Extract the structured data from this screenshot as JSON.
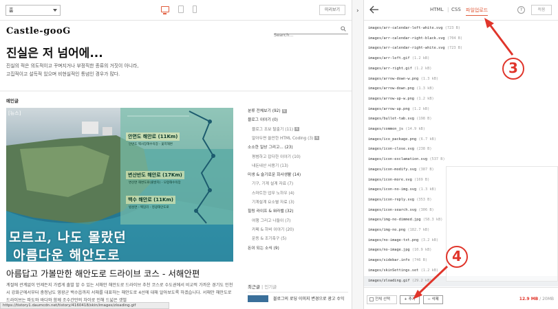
{
  "toolbar": {
    "skin_select_value": "홈",
    "preview_label": "미리보기"
  },
  "blog": {
    "logo": "Castle-gooG",
    "search_placeholder": "Search...",
    "hero_title": "진실은 저 넘어에...",
    "hero_desc_line1": "진실의 적은 의도적이고 꾸며지거나 부정직한 종류의 거짓이 아니라,",
    "hero_desc_line2": "고집적이고 설득적 있으며 비현실적인 통념인 경우가 많다.",
    "section_label": "메인글",
    "news_badge": "[뉴스]",
    "routes": [
      {
        "title": "안면도 해안로 (11Km)",
        "sub": "안면도 백사장해수욕장 - 꽃지해변"
      },
      {
        "title": "변산반도 해안로 (17Km)",
        "sub": "변산면 해변도로(출발지) - 모항해수욕장"
      },
      {
        "title": "백수 해안로 (11Km)",
        "sub": "법성면 - 백암리 - 영광해안도로"
      }
    ],
    "image_line1": "모르고, 나도 몰랐던",
    "image_line2": "아름다운 해안도로",
    "post_title": "아름답고 가볼만한 해안도로 드라이브 코스 - 서해안편",
    "post_excerpt": "계절에 관계없이 언제든지 가볍게 출발 할 수 있는 서해안 해안도로 드라이브 추천 코스로 수도권에서 비교적 가까운 경기도 인천시 강화군에서부터 충청남도 영광군 백수읍까지 서해를 대표하는 해안도로 4선에 대해 알아보도록 하겠습니다. 서해안 해안도로 드라이브는 파도와 바다와 함께 조수간만의 차이로 인해 드넓은 갯벌",
    "categories": [
      {
        "label": "분류 전체보기",
        "count": "(92)",
        "type": "top",
        "new": true
      },
      {
        "label": "블로그 이야기",
        "count": "(0)",
        "type": "top",
        "new": false
      },
      {
        "label": "블로그 조보 탈출기",
        "count": "(11)",
        "type": "sub",
        "new": true
      },
      {
        "label": "알아두면 쓸만한 HTML Coding",
        "count": "(3)",
        "type": "sub",
        "new": true
      },
      {
        "label": "소소한 일상 그리고...",
        "count": "(23)",
        "type": "top",
        "new": false
      },
      {
        "label": "평범하고 잡다한 이야기",
        "count": "(10)",
        "type": "sub",
        "new": false
      },
      {
        "label": "내돈내산 사용기",
        "count": "(13)",
        "type": "sub",
        "new": false
      },
      {
        "label": "미생 & 슬기로운 회사생활",
        "count": "(14)",
        "type": "top",
        "new": false
      },
      {
        "label": "기구, 기계 설계 자료",
        "count": "(7)",
        "type": "sub",
        "new": false
      },
      {
        "label": "스마트한 업무 노하우",
        "count": "(4)",
        "type": "sub",
        "new": false
      },
      {
        "label": "기계설계 요소별 자료",
        "count": "(3)",
        "type": "sub",
        "new": false
      },
      {
        "label": "힐링 라이프 & 워라밸",
        "count": "(32)",
        "type": "top",
        "new": false
      },
      {
        "label": "여행 그리고 나들이",
        "count": "(7)",
        "type": "sub",
        "new": false
      },
      {
        "label": "카페 & 하비 이야기",
        "count": "(20)",
        "type": "sub",
        "new": false
      },
      {
        "label": "운동 & 조기축구",
        "count": "(5)",
        "type": "sub",
        "new": false
      },
      {
        "label": "돈이 되는 소식",
        "count": "(9)",
        "type": "top",
        "new": false
      }
    ],
    "recent_label": "최근글",
    "recent_sep": "|",
    "popular_label": "인기글",
    "recent_post_title": "블로그의 로딩 이미지 변경으로 광고 수익 극대화하기",
    "status_url": "https://tistory1.daumcdn.net/tistory/4160418/skin/images/zloading.gif"
  },
  "editor": {
    "tab_html": "HTML",
    "tab_sep": "|",
    "tab_css": "CSS",
    "tab_upload": "파일업로드",
    "help": "?",
    "apply": "적용",
    "files": [
      {
        "name": "images/arr-calendar-left-white.svg",
        "size": "(723 B)"
      },
      {
        "name": "images/arr-calendar-right-black.svg",
        "size": "(704 B)"
      },
      {
        "name": "images/arr-calendar-right-white.svg",
        "size": "(723 B)"
      },
      {
        "name": "images/arr-left.gif",
        "size": "(1.2 kB)"
      },
      {
        "name": "images/arr-right.gif",
        "size": "(1.2 kB)"
      },
      {
        "name": "images/arrow-down-w.png",
        "size": "(1.3 kB)"
      },
      {
        "name": "images/arrow-down.png",
        "size": "(1.3 kB)"
      },
      {
        "name": "images/arrow-up-w.png",
        "size": "(1.2 kB)"
      },
      {
        "name": "images/arrow-up.png",
        "size": "(1.2 kB)"
      },
      {
        "name": "images/bullet-tab.svg",
        "size": "(198 B)"
      },
      {
        "name": "images/common_js",
        "size": "(14.9 kB)"
      },
      {
        "name": "images/ico_package.png",
        "size": "(6.7 kB)"
      },
      {
        "name": "images/icon-close.svg",
        "size": "(238 B)"
      },
      {
        "name": "images/icon-exclamation.svg",
        "size": "(537 B)"
      },
      {
        "name": "images/icon-modify.svg",
        "size": "(387 B)"
      },
      {
        "name": "images/icon-more.svg",
        "size": "(169 B)"
      },
      {
        "name": "images/icon-no-img.svg",
        "size": "(1.3 kB)"
      },
      {
        "name": "images/icon-reply.svg",
        "size": "(353 B)"
      },
      {
        "name": "images/icon-search.svg",
        "size": "(306 B)"
      },
      {
        "name": "images/img-no-dimmed.jpg",
        "size": "(58.3 kB)"
      },
      {
        "name": "images/img-no.png",
        "size": "(182.7 kB)"
      },
      {
        "name": "images/no-image-txt.png",
        "size": "(3.2 kB)"
      },
      {
        "name": "images/no-image.jpg",
        "size": "(10.9 kB)"
      },
      {
        "name": "images/sidebar.info",
        "size": "(746 B)"
      },
      {
        "name": "images/skinSettings.set",
        "size": "(1.2 kB)"
      },
      {
        "name": "images/zloading.gif",
        "size": "(29.2 kB)"
      }
    ],
    "select_all": "전체 선택",
    "add": "+ 추가",
    "delete": "− 삭제",
    "usage_used": "12.9 MB",
    "usage_total": " / 20MB"
  },
  "annotations": {
    "step3": "3",
    "step4": "4"
  },
  "colors": {
    "accent": "#e05a3a",
    "annotation_red": "#e0352b"
  }
}
